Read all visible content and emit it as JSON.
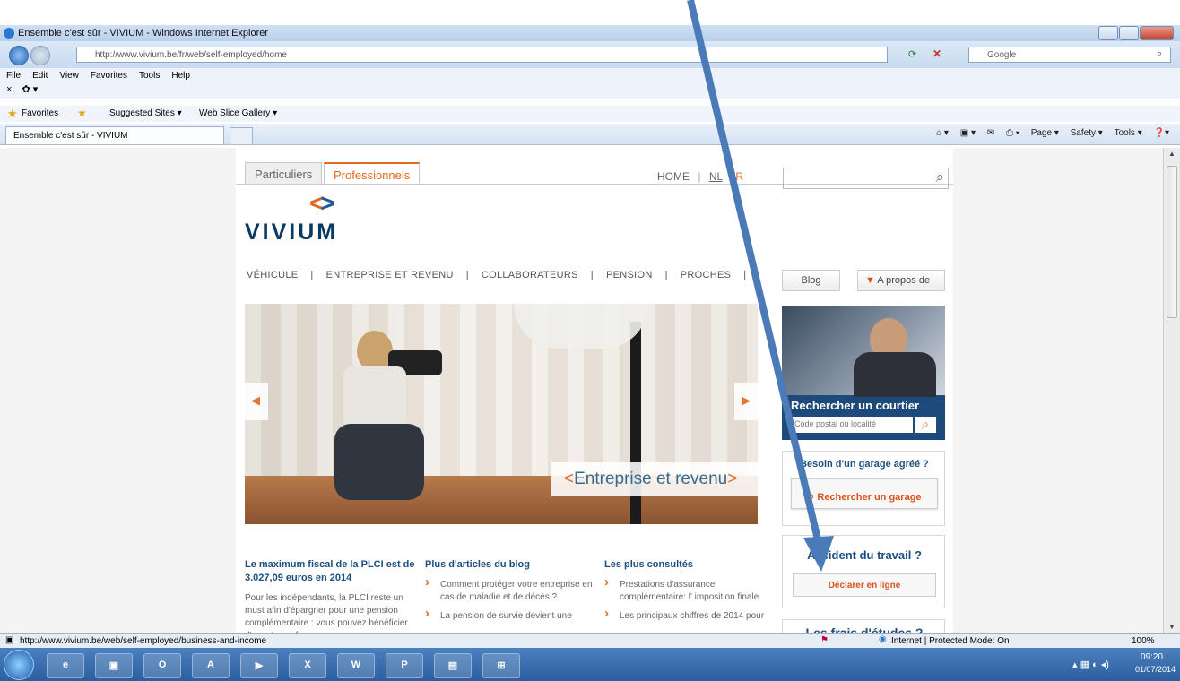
{
  "browser": {
    "title": "Ensemble c'est sûr - VIVIUM - Windows Internet Explorer",
    "url": "http://www.vivium.be/fr/web/self-employed/home",
    "search_placeholder": "Google",
    "menu": [
      "File",
      "Edit",
      "View",
      "Favorites",
      "Tools",
      "Help"
    ],
    "favorites": {
      "label": "Favorites",
      "suggested": "Suggested Sites ▾",
      "slice": "Web Slice Gallery ▾"
    },
    "tab_title": "Ensemble c'est sûr - VIVIUM",
    "tools": [
      "Page ▾",
      "Safety ▾",
      "Tools ▾"
    ],
    "status_url": "http://www.vivium.be/web/self-employed/business-and-income",
    "status_zone": "Internet | Protected Mode: On",
    "zoom": "100%",
    "time": "09:20",
    "date": "01/07/2014"
  },
  "site": {
    "tabs": [
      "Particuliers",
      "Professionnels"
    ],
    "logo": "VIVIUM",
    "top_links": {
      "home": "HOME",
      "nl": "NL",
      "fr": "FR"
    },
    "nav": [
      "VÉHICULE",
      "ENTREPRISE ET REVENU",
      "COLLABORATEURS",
      "PENSION",
      "PROCHES"
    ],
    "blog": "Blog",
    "apropos": "A propos de",
    "hero_caption": "Entreprise et revenu",
    "courtier": {
      "title": "Rechercher un courtier",
      "placeholder": "Code postal ou localité"
    },
    "garage": {
      "title": "Besoin d'un garage agréé ?",
      "button": "Rechercher un garage"
    },
    "accident": {
      "title": "Accident du travail ?",
      "button": "Déclarer en ligne"
    },
    "frais": "Les frais d'études ?",
    "col1": {
      "title": "Le maximum fiscal de la PLCI est de 3.027,09 euros en 2014",
      "text": "Pour les indépendants, la PLCI reste un must afin d'épargner pour une pension complémentaire : vous pouvez bénéficier d'avantages fiscaux"
    },
    "col2": {
      "title": "Plus d'articles du blog",
      "items": [
        "Comment protéger votre entreprise en cas de maladie et de décès ?",
        "La pension de survie devient une"
      ]
    },
    "col3": {
      "title": "Les plus consultés",
      "items": [
        "Prestations d'assurance complémentaire: l' imposition finale",
        "Les principaux chiffres de 2014 pour"
      ]
    }
  },
  "taskbar": [
    "e",
    "▣",
    "O",
    "A",
    "▶",
    "X",
    "W",
    "P",
    "▤",
    "⊞"
  ],
  "accent_color": "#e36b1f",
  "annotation_arrow_color": "#4a7ab8"
}
